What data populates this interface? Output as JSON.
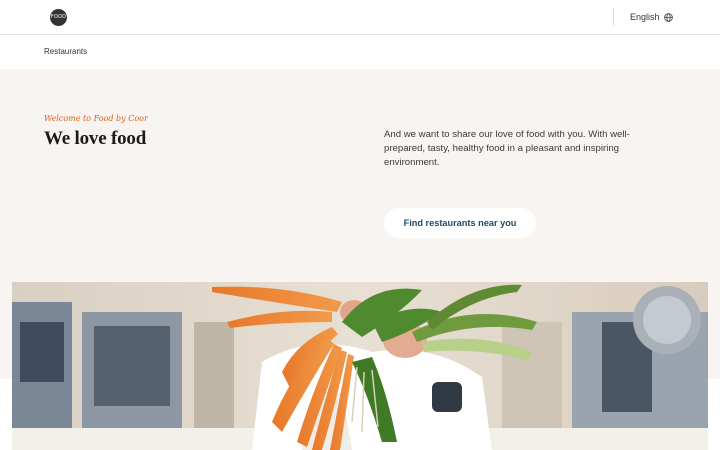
{
  "header": {
    "logo_text": "FOOD",
    "language_label": "English"
  },
  "breadcrumb": {
    "current": "Restaurants"
  },
  "hero": {
    "eyebrow": "Welcome to Food by Coor",
    "title": "We love food",
    "description": "And we want to share our love of food with you. With well-prepared, tasty, healthy food in a pleasant and inspiring environment.",
    "cta_label": "Find restaurants near you"
  },
  "colors": {
    "accent_orange": "#d9611c",
    "cta_text": "#1e4a66",
    "hero_bg": "#f7f4f2"
  }
}
